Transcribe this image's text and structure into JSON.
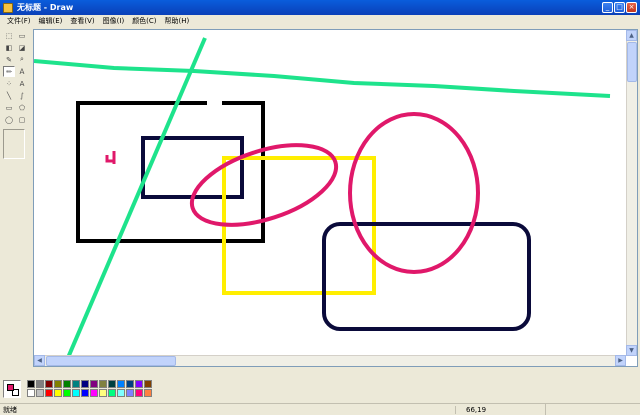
{
  "window": {
    "title": "无标题 - Draw"
  },
  "menu": [
    "文件(F)",
    "编辑(E)",
    "查看(V)",
    "图像(I)",
    "颜色(C)",
    "帮助(H)"
  ],
  "tools": [
    {
      "name": "free-select-icon",
      "glyph": "⬚"
    },
    {
      "name": "rect-select-icon",
      "glyph": "▭"
    },
    {
      "name": "eraser-icon",
      "glyph": "◧"
    },
    {
      "name": "fill-bucket-icon",
      "glyph": "◪"
    },
    {
      "name": "eyedropper-icon",
      "glyph": "✎"
    },
    {
      "name": "magnifier-icon",
      "glyph": "⌕"
    },
    {
      "name": "pencil-icon",
      "glyph": "✏"
    },
    {
      "name": "brush-icon",
      "glyph": "Ａ"
    },
    {
      "name": "airbrush-icon",
      "glyph": "⁘"
    },
    {
      "name": "text-icon",
      "glyph": "A"
    },
    {
      "name": "line-icon",
      "glyph": "╲"
    },
    {
      "name": "curve-icon",
      "glyph": "∫"
    },
    {
      "name": "rectangle-icon",
      "glyph": "▭"
    },
    {
      "name": "polygon-icon",
      "glyph": "⬠"
    },
    {
      "name": "ellipse-icon",
      "glyph": "◯"
    },
    {
      "name": "rounded-rect-icon",
      "glyph": "▢"
    }
  ],
  "palette": {
    "foreground": "#e0186a",
    "background": "#ffffff",
    "colors": [
      "#000000",
      "#808080",
      "#800000",
      "#808000",
      "#008000",
      "#008080",
      "#000080",
      "#800080",
      "#808040",
      "#004040",
      "#0080ff",
      "#004080",
      "#8000ff",
      "#804000",
      "#ffffff",
      "#c0c0c0",
      "#ff0000",
      "#ffff00",
      "#00ff00",
      "#00ffff",
      "#0000ff",
      "#ff00ff",
      "#ffff80",
      "#00ff80",
      "#80ffff",
      "#8080ff",
      "#ff0080",
      "#ff8040"
    ]
  },
  "drawing_colors": {
    "green": "#1ee38c",
    "navy": "#0a0a3a",
    "black": "#000000",
    "magenta": "#e0186a",
    "yellow": "#ffee00"
  },
  "status": {
    "text": "就绪",
    "coords": "66,19"
  }
}
